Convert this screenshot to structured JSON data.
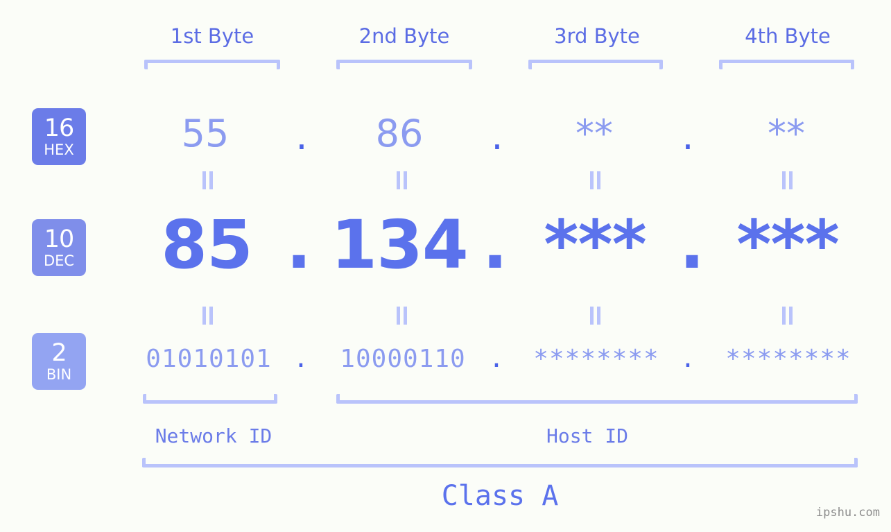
{
  "page": {
    "background_color": "#fbfdf8",
    "watermark": "ipshu.com"
  },
  "colors": {
    "accent_strong": "#5b72ec",
    "accent_mid": "#8b9bf0",
    "accent_light": "#b9c3fb",
    "dot": "#4a62e8",
    "badge_hex": "#6b7ce8",
    "badge_dec": "#7f8eea",
    "badge_bin": "#93a4f2",
    "header_text": "#5b6ce4",
    "watermark_text": "#8c8c8c"
  },
  "byte_headers": [
    {
      "label": "1st Byte"
    },
    {
      "label": "2nd Byte"
    },
    {
      "label": "3rd Byte"
    },
    {
      "label": "4th Byte"
    }
  ],
  "bases": [
    {
      "number": "16",
      "name": "HEX"
    },
    {
      "number": "10",
      "name": "DEC"
    },
    {
      "number": "2",
      "name": "BIN"
    }
  ],
  "rows": {
    "hex": {
      "base_number": "16",
      "base_name": "HEX",
      "values": [
        "55",
        "86",
        "**",
        "**"
      ],
      "separators": [
        ".",
        ".",
        "."
      ]
    },
    "dec": {
      "base_number": "10",
      "base_name": "DEC",
      "values": [
        "85",
        "134",
        "***",
        "***"
      ],
      "separators": [
        ".",
        ".",
        "."
      ]
    },
    "bin": {
      "base_number": "2",
      "base_name": "BIN",
      "values": [
        "01010101",
        "10000110",
        "********",
        "********"
      ],
      "separators": [
        ".",
        ".",
        "."
      ]
    }
  },
  "equals_symbol": "||",
  "sections": {
    "network_id": "Network ID",
    "host_id": "Host ID",
    "class": "Class A"
  },
  "ip_address": {
    "dec": "85.134.***.***",
    "hex": "55.86.**.**",
    "bin": "01010101.10000110.********.********"
  }
}
